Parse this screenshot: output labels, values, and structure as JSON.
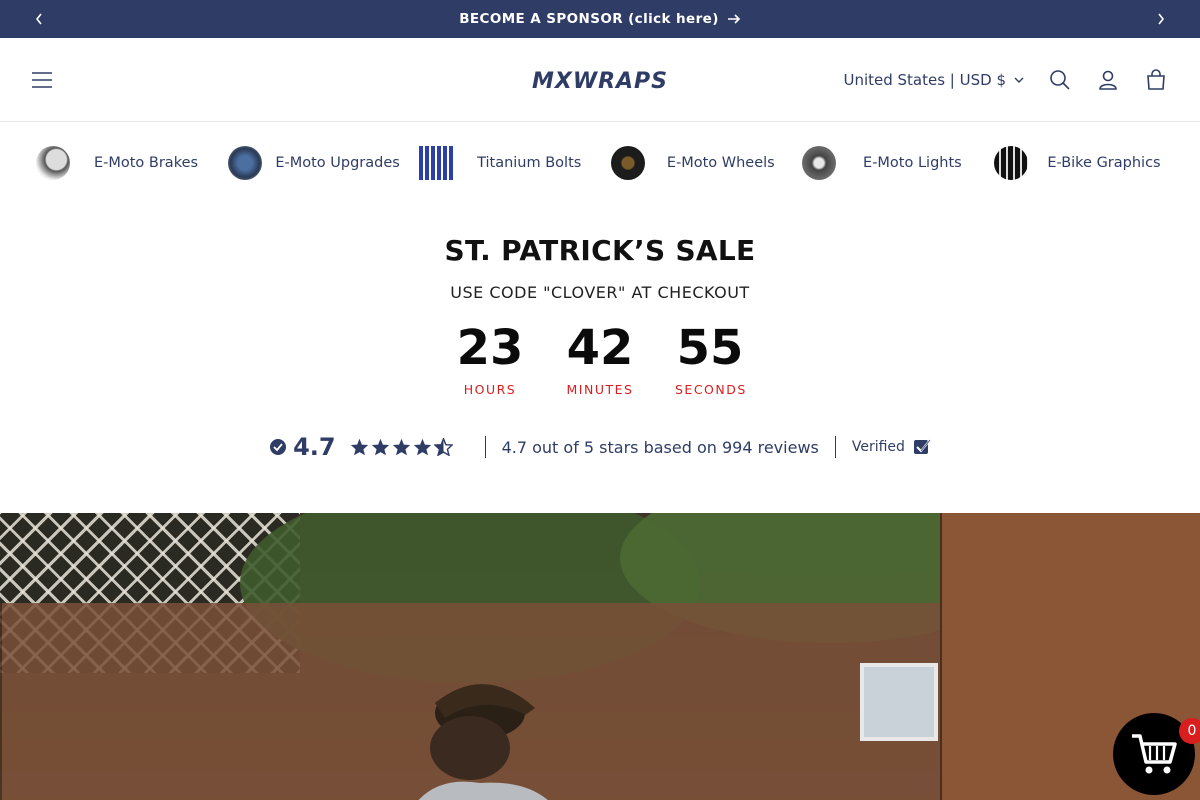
{
  "announcement": {
    "text": "BECOME A SPONSOR (click here)",
    "background": "#2f3d66"
  },
  "header": {
    "logo_text": "MXWRAPS",
    "country_selector": "United States | USD $"
  },
  "categories": [
    {
      "label": "E-Moto Brakes",
      "icon": "brake-thumbnail"
    },
    {
      "label": "E-Moto Upgrades",
      "icon": "upgrade-thumbnail"
    },
    {
      "label": "Titanium Bolts",
      "icon": "bolts-thumbnail"
    },
    {
      "label": "E-Moto Wheels",
      "icon": "wheel-thumbnail"
    },
    {
      "label": "E-Moto Lights",
      "icon": "light-thumbnail"
    },
    {
      "label": "E-Bike Graphics",
      "icon": "graphics-thumbnail"
    }
  ],
  "sale": {
    "title": "ST. PATRICK’S SALE",
    "code_text": "USE CODE \"CLOVER\" AT CHECKOUT",
    "countdown": [
      {
        "value": "23",
        "label": "HOURS"
      },
      {
        "value": "42",
        "label": "MINUTES"
      },
      {
        "value": "55",
        "label": "SECONDS"
      }
    ],
    "label_color": "#d81e1e"
  },
  "reviews": {
    "score": "4.7",
    "stars": 4.7,
    "summary": "4.7 out of 5 stars based on 994 reviews",
    "verified_label": "Verified"
  },
  "cart": {
    "count": "0"
  }
}
